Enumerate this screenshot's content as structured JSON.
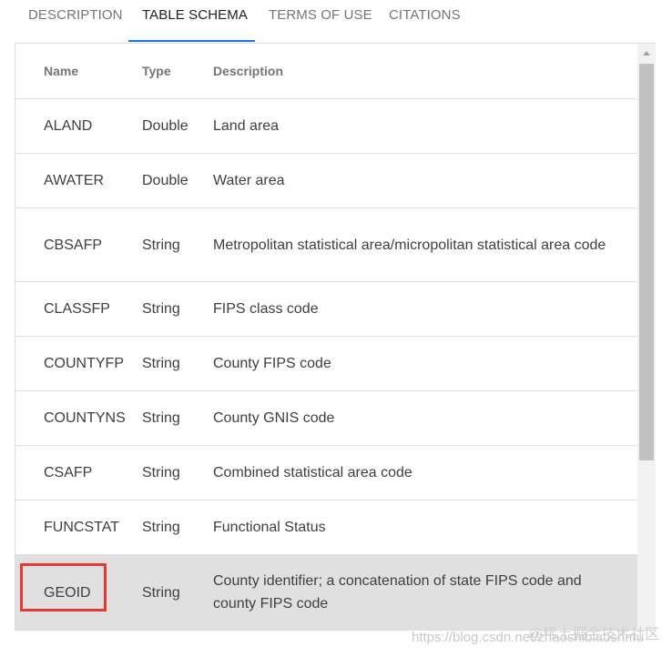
{
  "tabs": [
    {
      "label": "DESCRIPTION",
      "active": false
    },
    {
      "label": "TABLE SCHEMA",
      "active": true
    },
    {
      "label": "TERMS OF USE",
      "active": false
    },
    {
      "label": "CITATIONS",
      "active": false
    }
  ],
  "table": {
    "columns": [
      "Name",
      "Type",
      "Description"
    ],
    "rows": [
      {
        "name": "ALAND",
        "type": "Double",
        "description": "Land area"
      },
      {
        "name": "AWATER",
        "type": "Double",
        "description": "Water area"
      },
      {
        "name": "CBSAFP",
        "type": "String",
        "description": "Metropolitan statistical area/micropolitan statistical area code"
      },
      {
        "name": "CLASSFP",
        "type": "String",
        "description": "FIPS class code"
      },
      {
        "name": "COUNTYFP",
        "type": "String",
        "description": "County FIPS code"
      },
      {
        "name": "COUNTYNS",
        "type": "String",
        "description": "County GNIS code"
      },
      {
        "name": "CSAFP",
        "type": "String",
        "description": "Combined statistical area code"
      },
      {
        "name": "FUNCSTAT",
        "type": "String",
        "description": "Functional Status"
      },
      {
        "name": "GEOID",
        "type": "String",
        "description": "County identifier; a concatenation of state FIPS code and county FIPS code"
      }
    ]
  },
  "watermark": {
    "url": "https://blog.csdn.net/zhaoshibiaoshmu",
    "site": "@稀土掘金技术社区"
  },
  "colors": {
    "accent": "#1a73e8",
    "highlight": "#e53935",
    "selected_row": "#e0e0e0"
  }
}
